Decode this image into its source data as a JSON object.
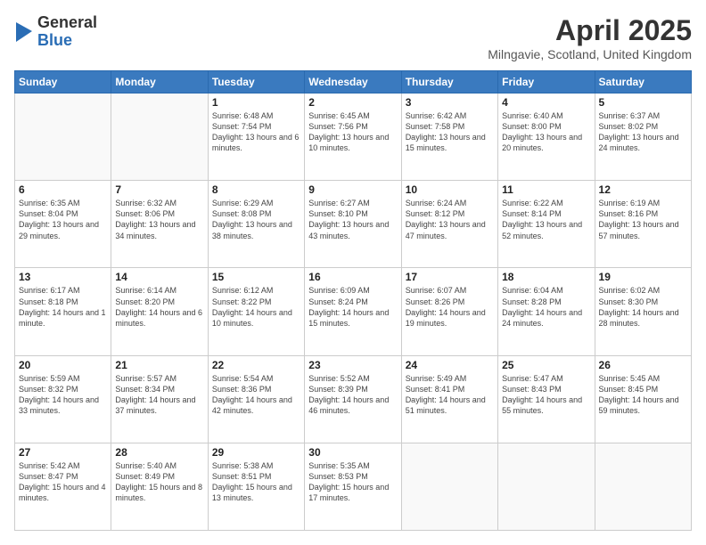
{
  "header": {
    "title": "April 2025",
    "subtitle": "Milngavie, Scotland, United Kingdom",
    "logo_general": "General",
    "logo_blue": "Blue"
  },
  "weekdays": [
    "Sunday",
    "Monday",
    "Tuesday",
    "Wednesday",
    "Thursday",
    "Friday",
    "Saturday"
  ],
  "weeks": [
    [
      {
        "day": "",
        "info": ""
      },
      {
        "day": "",
        "info": ""
      },
      {
        "day": "1",
        "info": "Sunrise: 6:48 AM\nSunset: 7:54 PM\nDaylight: 13 hours and 6 minutes."
      },
      {
        "day": "2",
        "info": "Sunrise: 6:45 AM\nSunset: 7:56 PM\nDaylight: 13 hours and 10 minutes."
      },
      {
        "day": "3",
        "info": "Sunrise: 6:42 AM\nSunset: 7:58 PM\nDaylight: 13 hours and 15 minutes."
      },
      {
        "day": "4",
        "info": "Sunrise: 6:40 AM\nSunset: 8:00 PM\nDaylight: 13 hours and 20 minutes."
      },
      {
        "day": "5",
        "info": "Sunrise: 6:37 AM\nSunset: 8:02 PM\nDaylight: 13 hours and 24 minutes."
      }
    ],
    [
      {
        "day": "6",
        "info": "Sunrise: 6:35 AM\nSunset: 8:04 PM\nDaylight: 13 hours and 29 minutes."
      },
      {
        "day": "7",
        "info": "Sunrise: 6:32 AM\nSunset: 8:06 PM\nDaylight: 13 hours and 34 minutes."
      },
      {
        "day": "8",
        "info": "Sunrise: 6:29 AM\nSunset: 8:08 PM\nDaylight: 13 hours and 38 minutes."
      },
      {
        "day": "9",
        "info": "Sunrise: 6:27 AM\nSunset: 8:10 PM\nDaylight: 13 hours and 43 minutes."
      },
      {
        "day": "10",
        "info": "Sunrise: 6:24 AM\nSunset: 8:12 PM\nDaylight: 13 hours and 47 minutes."
      },
      {
        "day": "11",
        "info": "Sunrise: 6:22 AM\nSunset: 8:14 PM\nDaylight: 13 hours and 52 minutes."
      },
      {
        "day": "12",
        "info": "Sunrise: 6:19 AM\nSunset: 8:16 PM\nDaylight: 13 hours and 57 minutes."
      }
    ],
    [
      {
        "day": "13",
        "info": "Sunrise: 6:17 AM\nSunset: 8:18 PM\nDaylight: 14 hours and 1 minute."
      },
      {
        "day": "14",
        "info": "Sunrise: 6:14 AM\nSunset: 8:20 PM\nDaylight: 14 hours and 6 minutes."
      },
      {
        "day": "15",
        "info": "Sunrise: 6:12 AM\nSunset: 8:22 PM\nDaylight: 14 hours and 10 minutes."
      },
      {
        "day": "16",
        "info": "Sunrise: 6:09 AM\nSunset: 8:24 PM\nDaylight: 14 hours and 15 minutes."
      },
      {
        "day": "17",
        "info": "Sunrise: 6:07 AM\nSunset: 8:26 PM\nDaylight: 14 hours and 19 minutes."
      },
      {
        "day": "18",
        "info": "Sunrise: 6:04 AM\nSunset: 8:28 PM\nDaylight: 14 hours and 24 minutes."
      },
      {
        "day": "19",
        "info": "Sunrise: 6:02 AM\nSunset: 8:30 PM\nDaylight: 14 hours and 28 minutes."
      }
    ],
    [
      {
        "day": "20",
        "info": "Sunrise: 5:59 AM\nSunset: 8:32 PM\nDaylight: 14 hours and 33 minutes."
      },
      {
        "day": "21",
        "info": "Sunrise: 5:57 AM\nSunset: 8:34 PM\nDaylight: 14 hours and 37 minutes."
      },
      {
        "day": "22",
        "info": "Sunrise: 5:54 AM\nSunset: 8:36 PM\nDaylight: 14 hours and 42 minutes."
      },
      {
        "day": "23",
        "info": "Sunrise: 5:52 AM\nSunset: 8:39 PM\nDaylight: 14 hours and 46 minutes."
      },
      {
        "day": "24",
        "info": "Sunrise: 5:49 AM\nSunset: 8:41 PM\nDaylight: 14 hours and 51 minutes."
      },
      {
        "day": "25",
        "info": "Sunrise: 5:47 AM\nSunset: 8:43 PM\nDaylight: 14 hours and 55 minutes."
      },
      {
        "day": "26",
        "info": "Sunrise: 5:45 AM\nSunset: 8:45 PM\nDaylight: 14 hours and 59 minutes."
      }
    ],
    [
      {
        "day": "27",
        "info": "Sunrise: 5:42 AM\nSunset: 8:47 PM\nDaylight: 15 hours and 4 minutes."
      },
      {
        "day": "28",
        "info": "Sunrise: 5:40 AM\nSunset: 8:49 PM\nDaylight: 15 hours and 8 minutes."
      },
      {
        "day": "29",
        "info": "Sunrise: 5:38 AM\nSunset: 8:51 PM\nDaylight: 15 hours and 13 minutes."
      },
      {
        "day": "30",
        "info": "Sunrise: 5:35 AM\nSunset: 8:53 PM\nDaylight: 15 hours and 17 minutes."
      },
      {
        "day": "",
        "info": ""
      },
      {
        "day": "",
        "info": ""
      },
      {
        "day": "",
        "info": ""
      }
    ]
  ]
}
